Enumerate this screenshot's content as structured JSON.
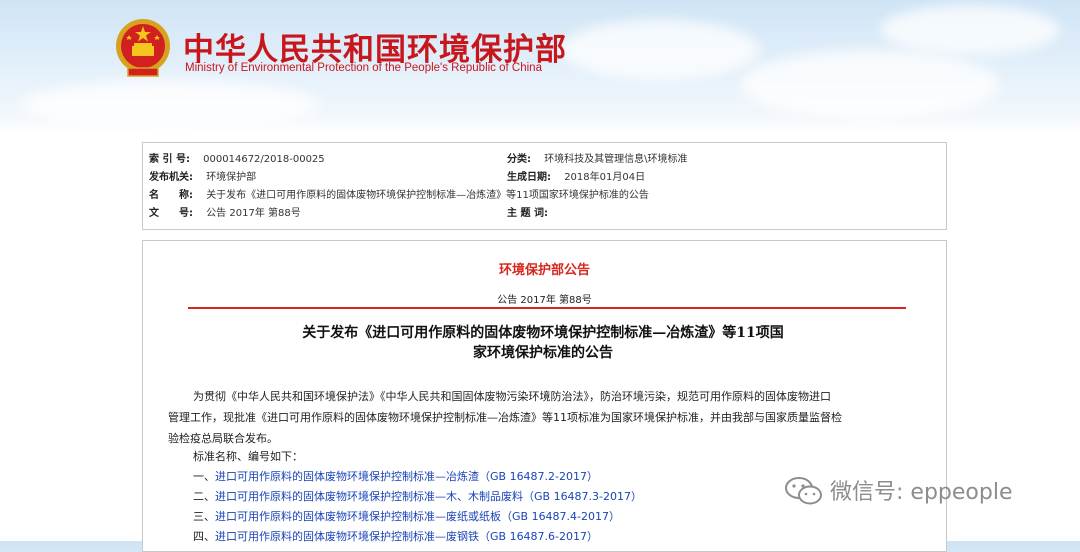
{
  "header": {
    "title": "中华人民共和国环境保护部",
    "subtitle": "Ministry of Environmental Protection of the People's Republic of China"
  },
  "meta": {
    "index_label": "索 引 号:",
    "index_value": "000014672/2018-00025",
    "category_label": "分类:",
    "category_value": "环境科技及其管理信息\\环境标准",
    "issuer_label": "发布机关:",
    "issuer_value": "环境保护部",
    "date_label": "生成日期:",
    "date_value": "2018年01月04日",
    "name_label": "名　　称:",
    "name_value": "关于发布《进口可用作原料的固体废物环境保护控制标准—冶炼渣》等11项国家环境保护标准的公告",
    "docno_label": "文　　号:",
    "docno_value": "公告 2017年 第88号",
    "subject_label": "主 题 词:",
    "subject_value": ""
  },
  "notice": {
    "title": "环境保护部公告",
    "number": "公告 2017年 第88号",
    "doc_title_line1": "关于发布《进口可用作原料的固体废物环境保护控制标准—冶炼渣》等11项国",
    "doc_title_line2": "家环境保护标准的公告",
    "paragraph1_line1": "为贯彻《中华人民共和国环境保护法》《中华人民共和国固体废物污染环境防治法》，防治环境污染，规范可用作原料的固体废物进口",
    "paragraph1_line2": "管理工作，现批准《进口可用作原料的固体废物环境保护控制标准—冶炼渣》等11项标准为国家环境保护标准，并由我部与国家质量监督检",
    "paragraph1_line3": "验检疫总局联合发布。",
    "list_intro": "标准名称、编号如下：",
    "standards": [
      {
        "prefix": "一、",
        "link": "进口可用作原料的固体废物环境保护控制标准—冶炼渣（GB 16487.2-2017）"
      },
      {
        "prefix": "二、",
        "link": "进口可用作原料的固体废物环境保护控制标准—木、木制品废料（GB 16487.3-2017）"
      },
      {
        "prefix": "三、",
        "link": "进口可用作原料的固体废物环境保护控制标准—废纸或纸板（GB 16487.4-2017）"
      },
      {
        "prefix": "四、",
        "link": "进口可用作原料的固体废物环境保护控制标准—废钢铁（GB 16487.6-2017）"
      }
    ]
  },
  "watermark": {
    "text": "微信号: eppeople",
    "icon": "wechat-icon"
  },
  "colors": {
    "brand_red": "#c8161d",
    "link_blue": "#1a44b8"
  }
}
